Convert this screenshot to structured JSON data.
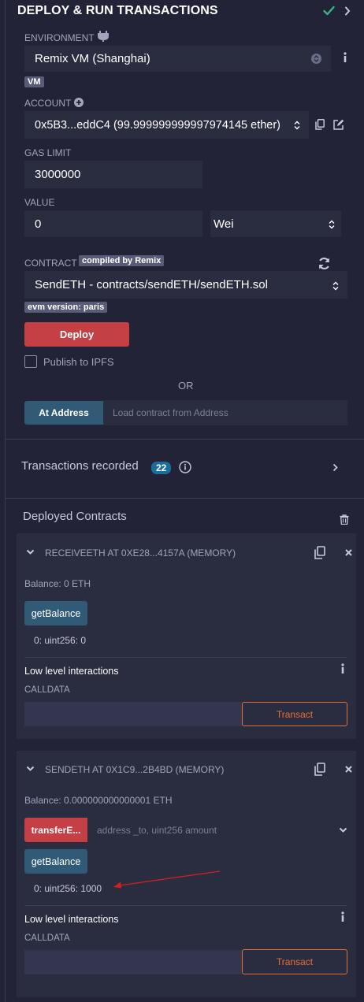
{
  "header": {
    "title": "DEPLOY & RUN TRANSACTIONS",
    "status_color": "#3fb083"
  },
  "environment": {
    "label": "ENVIRONMENT",
    "value": "Remix VM (Shanghai)",
    "badge": "VM"
  },
  "account": {
    "label": "ACCOUNT",
    "value": "0x5B3...eddC4 (99.999999999997974145 ether)"
  },
  "gas_limit": {
    "label": "GAS LIMIT",
    "value": "3000000"
  },
  "value_field": {
    "label": "VALUE",
    "amount": "0",
    "unit": "Wei"
  },
  "contract": {
    "label": "CONTRACT",
    "compiled_badge": "compiled by Remix",
    "value": "SendETH - contracts/sendETH/sendETH.sol",
    "evm_badge": "evm version: paris"
  },
  "deploy_button": "Deploy",
  "publish_ipfs": "Publish to IPFS",
  "or_text": "OR",
  "at_address": {
    "button": "At Address",
    "placeholder": "Load contract from Address"
  },
  "transactions": {
    "label": "Transactions recorded",
    "count": "22"
  },
  "deployed": {
    "title": "Deployed Contracts",
    "contracts": [
      {
        "name": "RECEIVEETH AT 0XE28...4157A (MEMORY)",
        "balance": "Balance: 0 ETH",
        "get_balance_button": "getBalance",
        "result": "0: uint256: 0",
        "low_level": "Low level interactions",
        "calldata_label": "CALLDATA",
        "transact_button": "Transact"
      },
      {
        "name": "SENDETH AT 0X1C9...2B4BD (MEMORY)",
        "balance": "Balance: 0.000000000000001 ETH",
        "transfer_button": "transferE...",
        "transfer_placeholder": "address _to, uint256 amount",
        "get_balance_button": "getBalance",
        "result": "0: uint256: 1000",
        "low_level": "Low level interactions",
        "calldata_label": "CALLDATA",
        "transact_button": "Transact"
      }
    ]
  },
  "colors": {
    "background": "#222336",
    "field": "#2a2c3f",
    "danger": "#c44044",
    "primary": "#305a75",
    "warning": "#e56d3b",
    "badge_blue": "#1b6e9c",
    "annotation_arrow": "#d42020"
  }
}
